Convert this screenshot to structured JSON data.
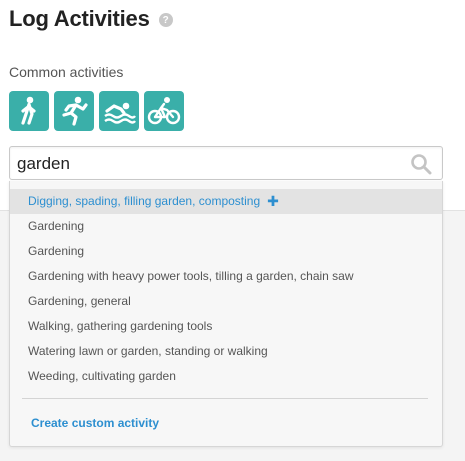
{
  "header": {
    "title": "Log Activities",
    "help_icon": "?"
  },
  "common": {
    "label": "Common activities",
    "activities": [
      {
        "icon": "walking-icon"
      },
      {
        "icon": "running-icon"
      },
      {
        "icon": "swimming-icon"
      },
      {
        "icon": "cycling-icon"
      }
    ]
  },
  "search": {
    "value": "garden",
    "placeholder": ""
  },
  "results": {
    "items": [
      "Digging, spading, filling garden, composting",
      "Gardening",
      "Gardening",
      "Gardening with heavy power tools, tilling a garden, chain saw",
      "Gardening, general",
      "Walking, gathering gardening tools",
      "Watering lawn or garden, standing or walking",
      "Weeding, cultivating garden"
    ],
    "add_symbol": "✚",
    "create_label": "Create custom activity"
  },
  "colors": {
    "accent_teal": "#3aafa9",
    "link_blue": "#2d8fd0"
  }
}
